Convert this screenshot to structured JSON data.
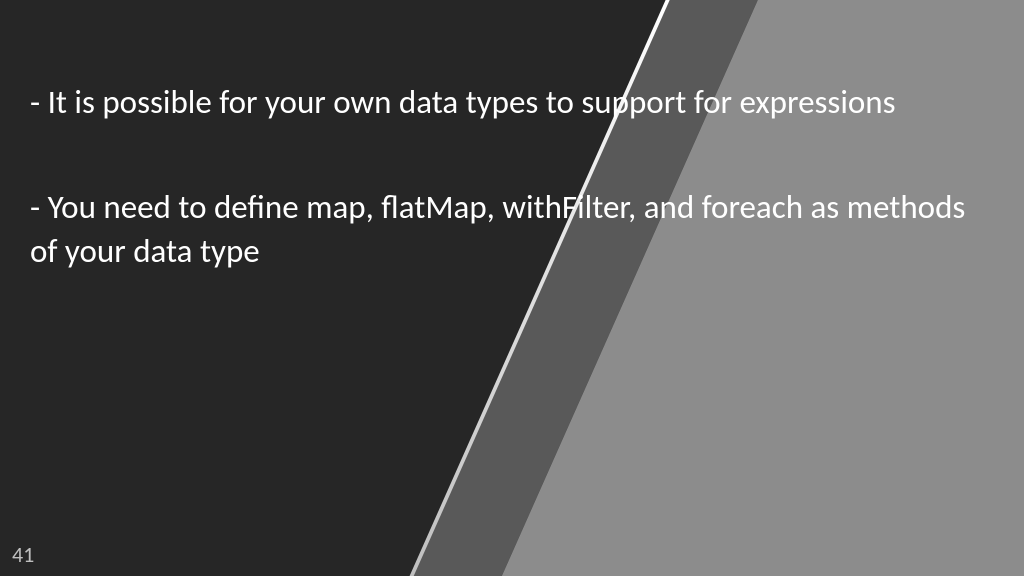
{
  "slide": {
    "bullets": [
      "- It is possible for your own data types to support for expressions",
      "- You need to define map, flatMap, withFilter, and foreach as methods of your data type"
    ],
    "page_number": "41"
  },
  "colors": {
    "bg_dark": "#262626",
    "bg_mid": "#595959",
    "bg_light": "#8c8c8c",
    "text": "#ffffff",
    "page_num": "#bfbfbf"
  }
}
